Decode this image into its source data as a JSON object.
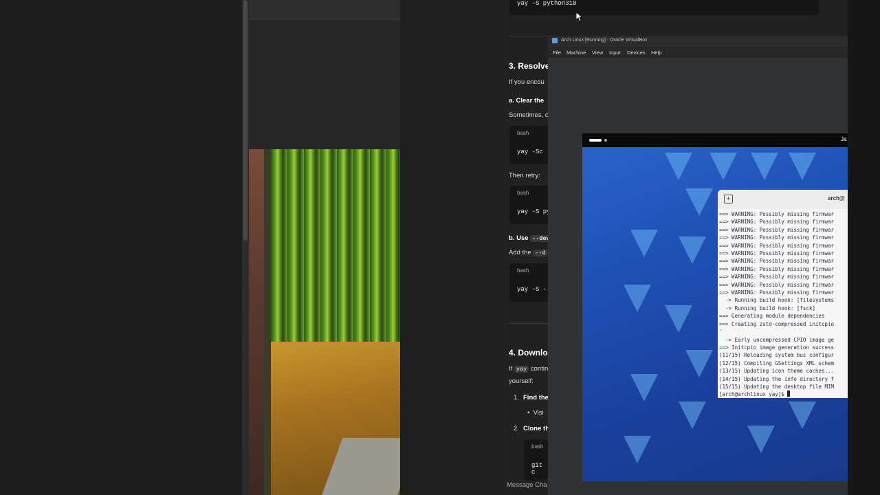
{
  "article": {
    "top_code": "yay -S python310",
    "section3_title": "3. Resolve",
    "section3_intro": "If you encou",
    "sub_a_title": "a. Clear the",
    "sub_a_text": "Sometimes, c",
    "code_lang": "bash",
    "code_a": "yay -Sc",
    "then_retry": "Then retry:",
    "code_b": "yay -S py",
    "sub_b_prefix": "b. Use",
    "sub_b_inline": "--dev",
    "add_the_prefix": "Add the",
    "add_the_inline": "--d",
    "code_c": "yay -S --",
    "section4_title": "4. Downlo",
    "section4_if": "If",
    "section4_inline": "yay",
    "section4_rest": "contin",
    "section4_yourself": "yourself:",
    "step1_num": "1.",
    "step1_label": "Find the",
    "step1_bullet": "Visi",
    "step2_num": "2.",
    "step2_label": "Clone th",
    "code_d": "git c",
    "message_placeholder": "Message Cha"
  },
  "vbox": {
    "title": "Arch Linux [Running] - Oracle VirtualBox",
    "menu": [
      "File",
      "Machine",
      "View",
      "Input",
      "Devices",
      "Help"
    ],
    "guest_clock": "Ja",
    "terminal_title": "arch@",
    "terminal_lines": [
      "==> WARNING: Possibly missing firmwar",
      "==> WARNING: Possibly missing firmwar",
      "==> WARNING: Possibly missing firmwar",
      "==> WARNING: Possibly missing firmwar",
      "==> WARNING: Possibly missing firmwar",
      "==> WARNING: Possibly missing firmwar",
      "==> WARNING: Possibly missing firmwar",
      "==> WARNING: Possibly missing firmwar",
      "==> WARNING: Possibly missing firmwar",
      "==> WARNING: Possibly missing firmwar",
      "==> WARNING: Possibly missing firmwar",
      "  -> Running build hook: [filesystems",
      "  -> Running build hook: [fsck]",
      "==> Generating module dependencies",
      "==> Creating zstd-compressed initcpio",
      "'",
      "  -> Early uncompressed CPIO image ge",
      "==> Initcpio image generation success",
      "(11/15) Reloading system bus configur",
      "(12/15) Compiling GSettings XML schem",
      "(13/15) Updating icon theme caches...",
      "(14/15) Updating the info directory f",
      "(15/15) Updating the desktop file MIM",
      "[arch@archlinux yay]$ "
    ]
  }
}
